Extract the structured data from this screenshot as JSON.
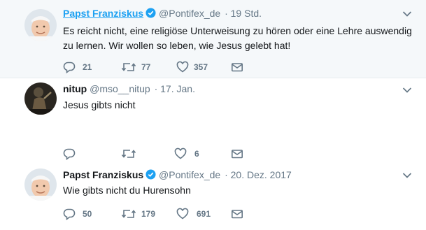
{
  "tweets": [
    {
      "name": "Papst Franziskus",
      "handle": "@Pontifex_de",
      "time": "· 19 Std.",
      "verified": true,
      "text": "Es reicht nicht, eine religiöse Unterweisung zu hören oder eine Lehre auswendig zu lernen. Wir wollen so leben, wie Jesus gelebt hat!",
      "replies": "21",
      "retweets": "77",
      "likes": "357"
    },
    {
      "name": "nitup",
      "handle": "@mso__nitup",
      "time": "· 17. Jan.",
      "verified": false,
      "text": "Jesus gibts nicht",
      "replies": "",
      "retweets": "",
      "likes": "6"
    },
    {
      "name": "Papst Franziskus",
      "handle": "@Pontifex_de",
      "time": "· 20. Dez. 2017",
      "verified": true,
      "text": "Wie gibts nicht du Hurensohn",
      "replies": "50",
      "retweets": "179",
      "likes": "691"
    }
  ],
  "icons": {
    "reply": "reply-icon",
    "retweet": "retweet-icon",
    "like": "heart-icon",
    "message": "envelope-icon",
    "more": "chevron-down-icon",
    "verified": "verified-badge-icon"
  },
  "colors": {
    "accent": "#1da1f2",
    "text": "#14171a",
    "muted": "#657786",
    "highlight_bg": "#f5f8fa",
    "thread_line": "#ccd6dd"
  }
}
